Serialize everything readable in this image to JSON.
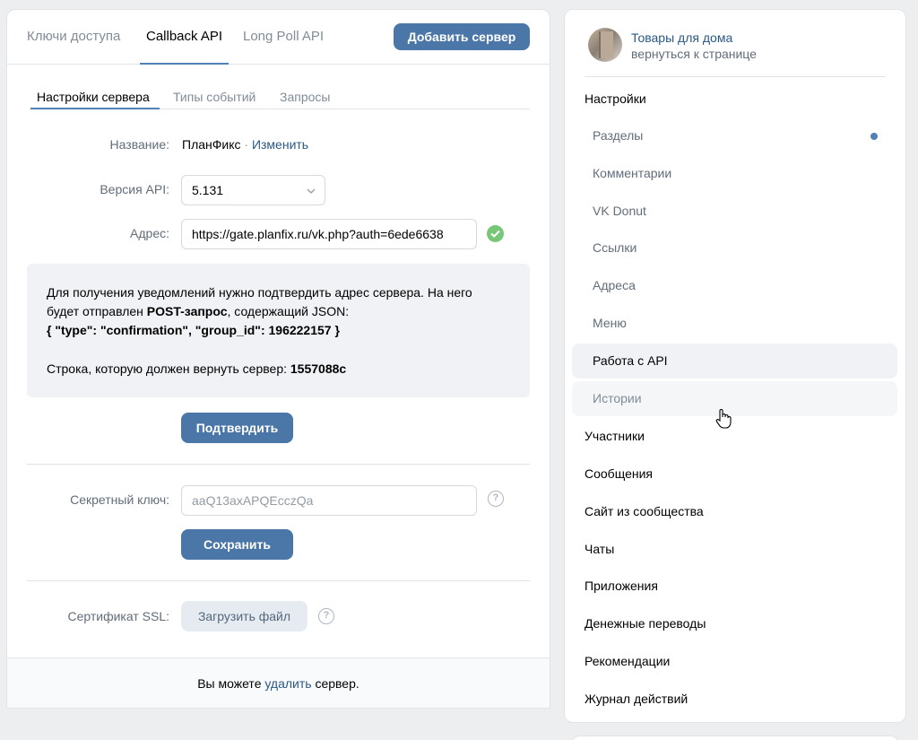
{
  "tabs": {
    "keys": "Ключи доступа",
    "callback": "Callback API",
    "longpoll": "Long Poll API",
    "add_server": "Добавить сервер"
  },
  "subtabs": {
    "settings": "Настройки сервера",
    "events": "Типы событий",
    "requests": "Запросы"
  },
  "form": {
    "name_label": "Название:",
    "name_value": "ПланФикс",
    "name_sep": " · ",
    "name_edit": "Изменить",
    "api_label": "Версия API:",
    "api_value": "5.131",
    "address_label": "Адрес:",
    "address_value": "https://gate.planfix.ru/vk.php?auth=6ede6638",
    "secret_label": "Секретный ключ:",
    "secret_value": "aaQ13axAPQEcczQa",
    "ssl_label": "Сертификат SSL:",
    "help": "?"
  },
  "info": {
    "line1": "Для получения уведомлений нужно подтвердить адрес сервера. На него",
    "line2_prefix": "будет отправлен ",
    "line2_bold": "POST-запрос",
    "line2_suffix": ", содержащий JSON:",
    "json": "{ \"type\": \"confirmation\", \"group_id\": 196222157 }",
    "return_prefix": "Строка, которую должен вернуть сервер: ",
    "return_code": "1557088c"
  },
  "buttons": {
    "confirm": "Подтвердить",
    "save": "Сохранить",
    "upload": "Загрузить файл"
  },
  "footer": {
    "prefix": "Вы можете ",
    "link": "удалить",
    "suffix": " сервер."
  },
  "sidebar": {
    "group_name": "Товары для дома",
    "back": "вернуться к странице",
    "settings": "Настройки",
    "sub_items": [
      "Разделы",
      "Комментарии",
      "VK Donut",
      "Ссылки",
      "Адреса",
      "Меню",
      "Работа с API",
      "Истории"
    ],
    "items": [
      "Участники",
      "Сообщения",
      "Сайт из сообщества",
      "Чаты",
      "Приложения",
      "Денежные переводы",
      "Рекомендации",
      "Журнал действий"
    ]
  },
  "colors": {
    "accent": "#4a76a8",
    "link": "#2a5885",
    "check": "#4bb34b"
  }
}
